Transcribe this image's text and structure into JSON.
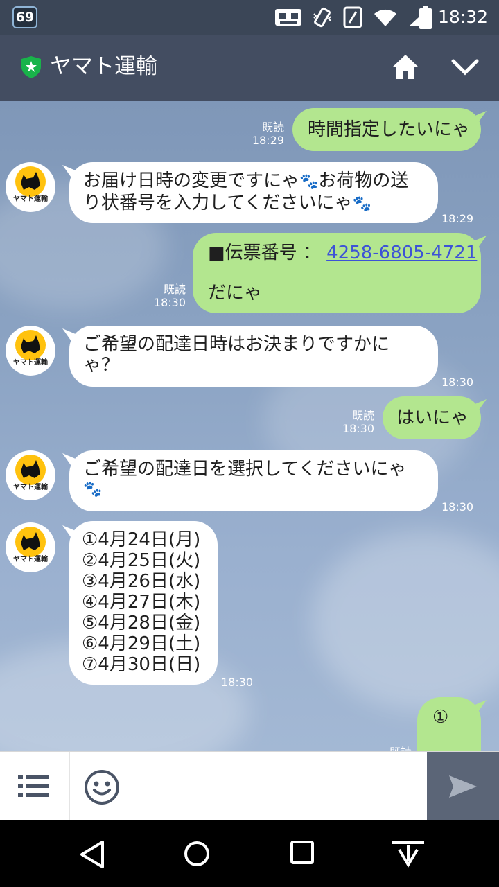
{
  "status_bar": {
    "badge": "69",
    "time": "18:32",
    "icons": [
      "voicemail-icon",
      "vibrate-icon",
      "nfc-icon",
      "wifi-icon",
      "signal-icon",
      "battery-icon"
    ]
  },
  "header": {
    "title": "ヤマト運輸",
    "shield_color": "#19b34a"
  },
  "avatar_label": "ヤマト運輸",
  "messages": {
    "m1": {
      "text": "時間指定したいにゃ",
      "read": "既読",
      "time": "18:29"
    },
    "m2": {
      "line1": "お届け日時の変更ですにゃ",
      "line1b": "お荷物の送",
      "line2": "り状番号を入力してくださいにゃ",
      "time": "18:29"
    },
    "m3": {
      "prefix": "■伝票番号 ： ",
      "number": "4258-6805-4721",
      "line2": "だにゃ",
      "read": "既読",
      "time": "18:30"
    },
    "m4": {
      "line1": "ご希望の配達日時はお決まりですかに",
      "line2": "ゃ？",
      "time": "18:30"
    },
    "m5": {
      "text": "はいにゃ",
      "read": "既読",
      "time": "18:30"
    },
    "m6": {
      "line1": "ご希望の配達日を選択してくださいにゃ",
      "time": "18:30"
    },
    "m7": {
      "dates": [
        "①4月24日(月)",
        "②4月25日(火)",
        "③4月26日(水)",
        "④4月27日(木)",
        "⑤4月28日(金)",
        "⑥4月29日(土)",
        "⑦4月30日(日)"
      ],
      "time": "18:30"
    },
    "m8": {
      "text": "①",
      "read": "既読"
    }
  },
  "input": {
    "placeholder": ""
  },
  "colors": {
    "sent_bubble": "#b3e68f",
    "received_bubble": "#ffffff",
    "header": "#434d61"
  }
}
